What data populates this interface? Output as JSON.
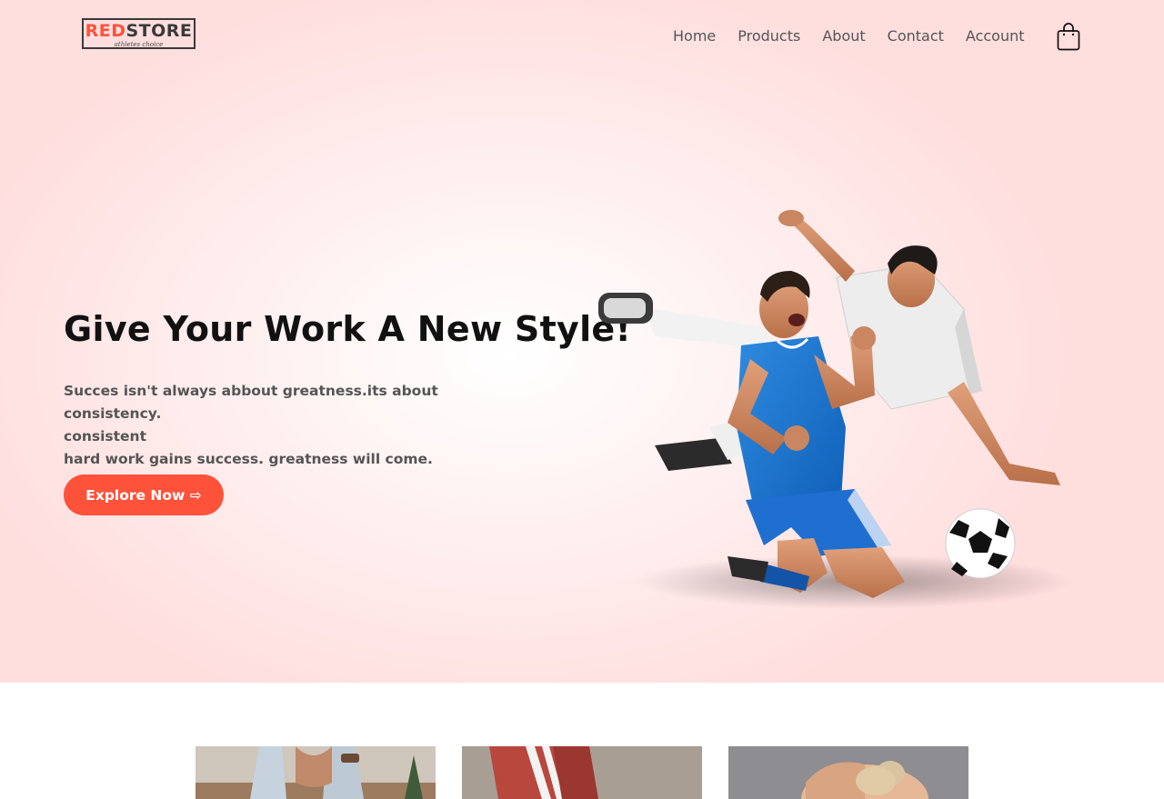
{
  "brand": {
    "logo_red": "RED",
    "logo_dark": "STORE",
    "tagline": "athletes choice",
    "accent_color": "#ff523b"
  },
  "nav": {
    "items": [
      {
        "label": "Home"
      },
      {
        "label": "Products"
      },
      {
        "label": "About"
      },
      {
        "label": "Contact"
      },
      {
        "label": "Account"
      }
    ],
    "cart_icon": "shopping-bag-icon"
  },
  "hero": {
    "title": "Give Your Work A New Style!",
    "desc_lines": [
      "Succes isn't always abbout greatness.its about consistency.",
      "consistent",
      "hard work gains success. greatness will come."
    ],
    "button_label": "Explore Now ⇨",
    "image": "football-players-image"
  },
  "categories": [
    {
      "image": "category-jeans-image"
    },
    {
      "image": "category-sportswear-image"
    },
    {
      "image": "category-fitness-image"
    }
  ]
}
